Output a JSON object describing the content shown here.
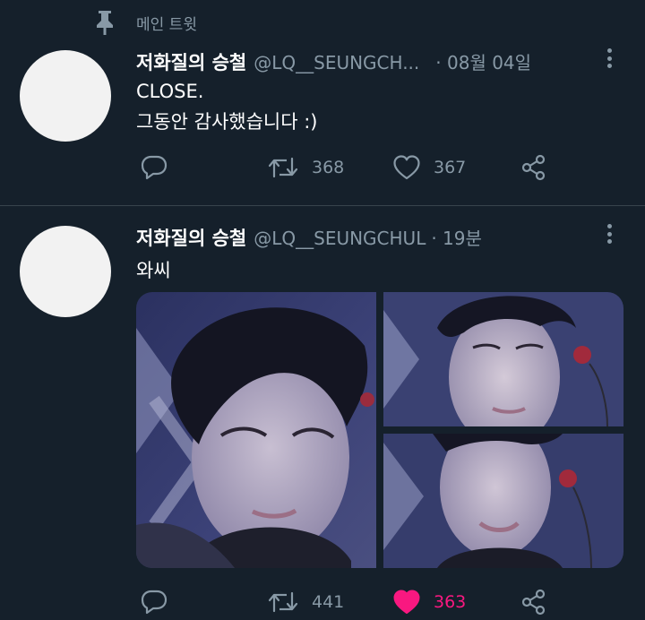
{
  "pinned": {
    "label": "메인 트윗",
    "icon": "pin-icon"
  },
  "tweets": [
    {
      "author": {
        "name": "저화질의 승철",
        "handle": "@LQ__SEUNGCH...",
        "avatar": "avatar-placeholder"
      },
      "meta": "· 08월 04일",
      "lines": [
        "CLOSE.",
        "그동안 감사했습니다 :)"
      ],
      "actions": {
        "reply": "",
        "retweet": "368",
        "like": "367",
        "liked": false
      }
    },
    {
      "author": {
        "name": "저화질의 승철",
        "handle": "@LQ__SEUNGCHUL",
        "avatar": "avatar-placeholder"
      },
      "meta": "· 19분",
      "lines": [
        "와씨"
      ],
      "media_count": 3,
      "actions": {
        "reply": "",
        "retweet": "441",
        "like": "363",
        "liked": true
      }
    }
  ],
  "colors": {
    "background": "#15202b",
    "secondary_text": "#8899a6",
    "like_active": "#f91880",
    "divider": "#38444d"
  }
}
